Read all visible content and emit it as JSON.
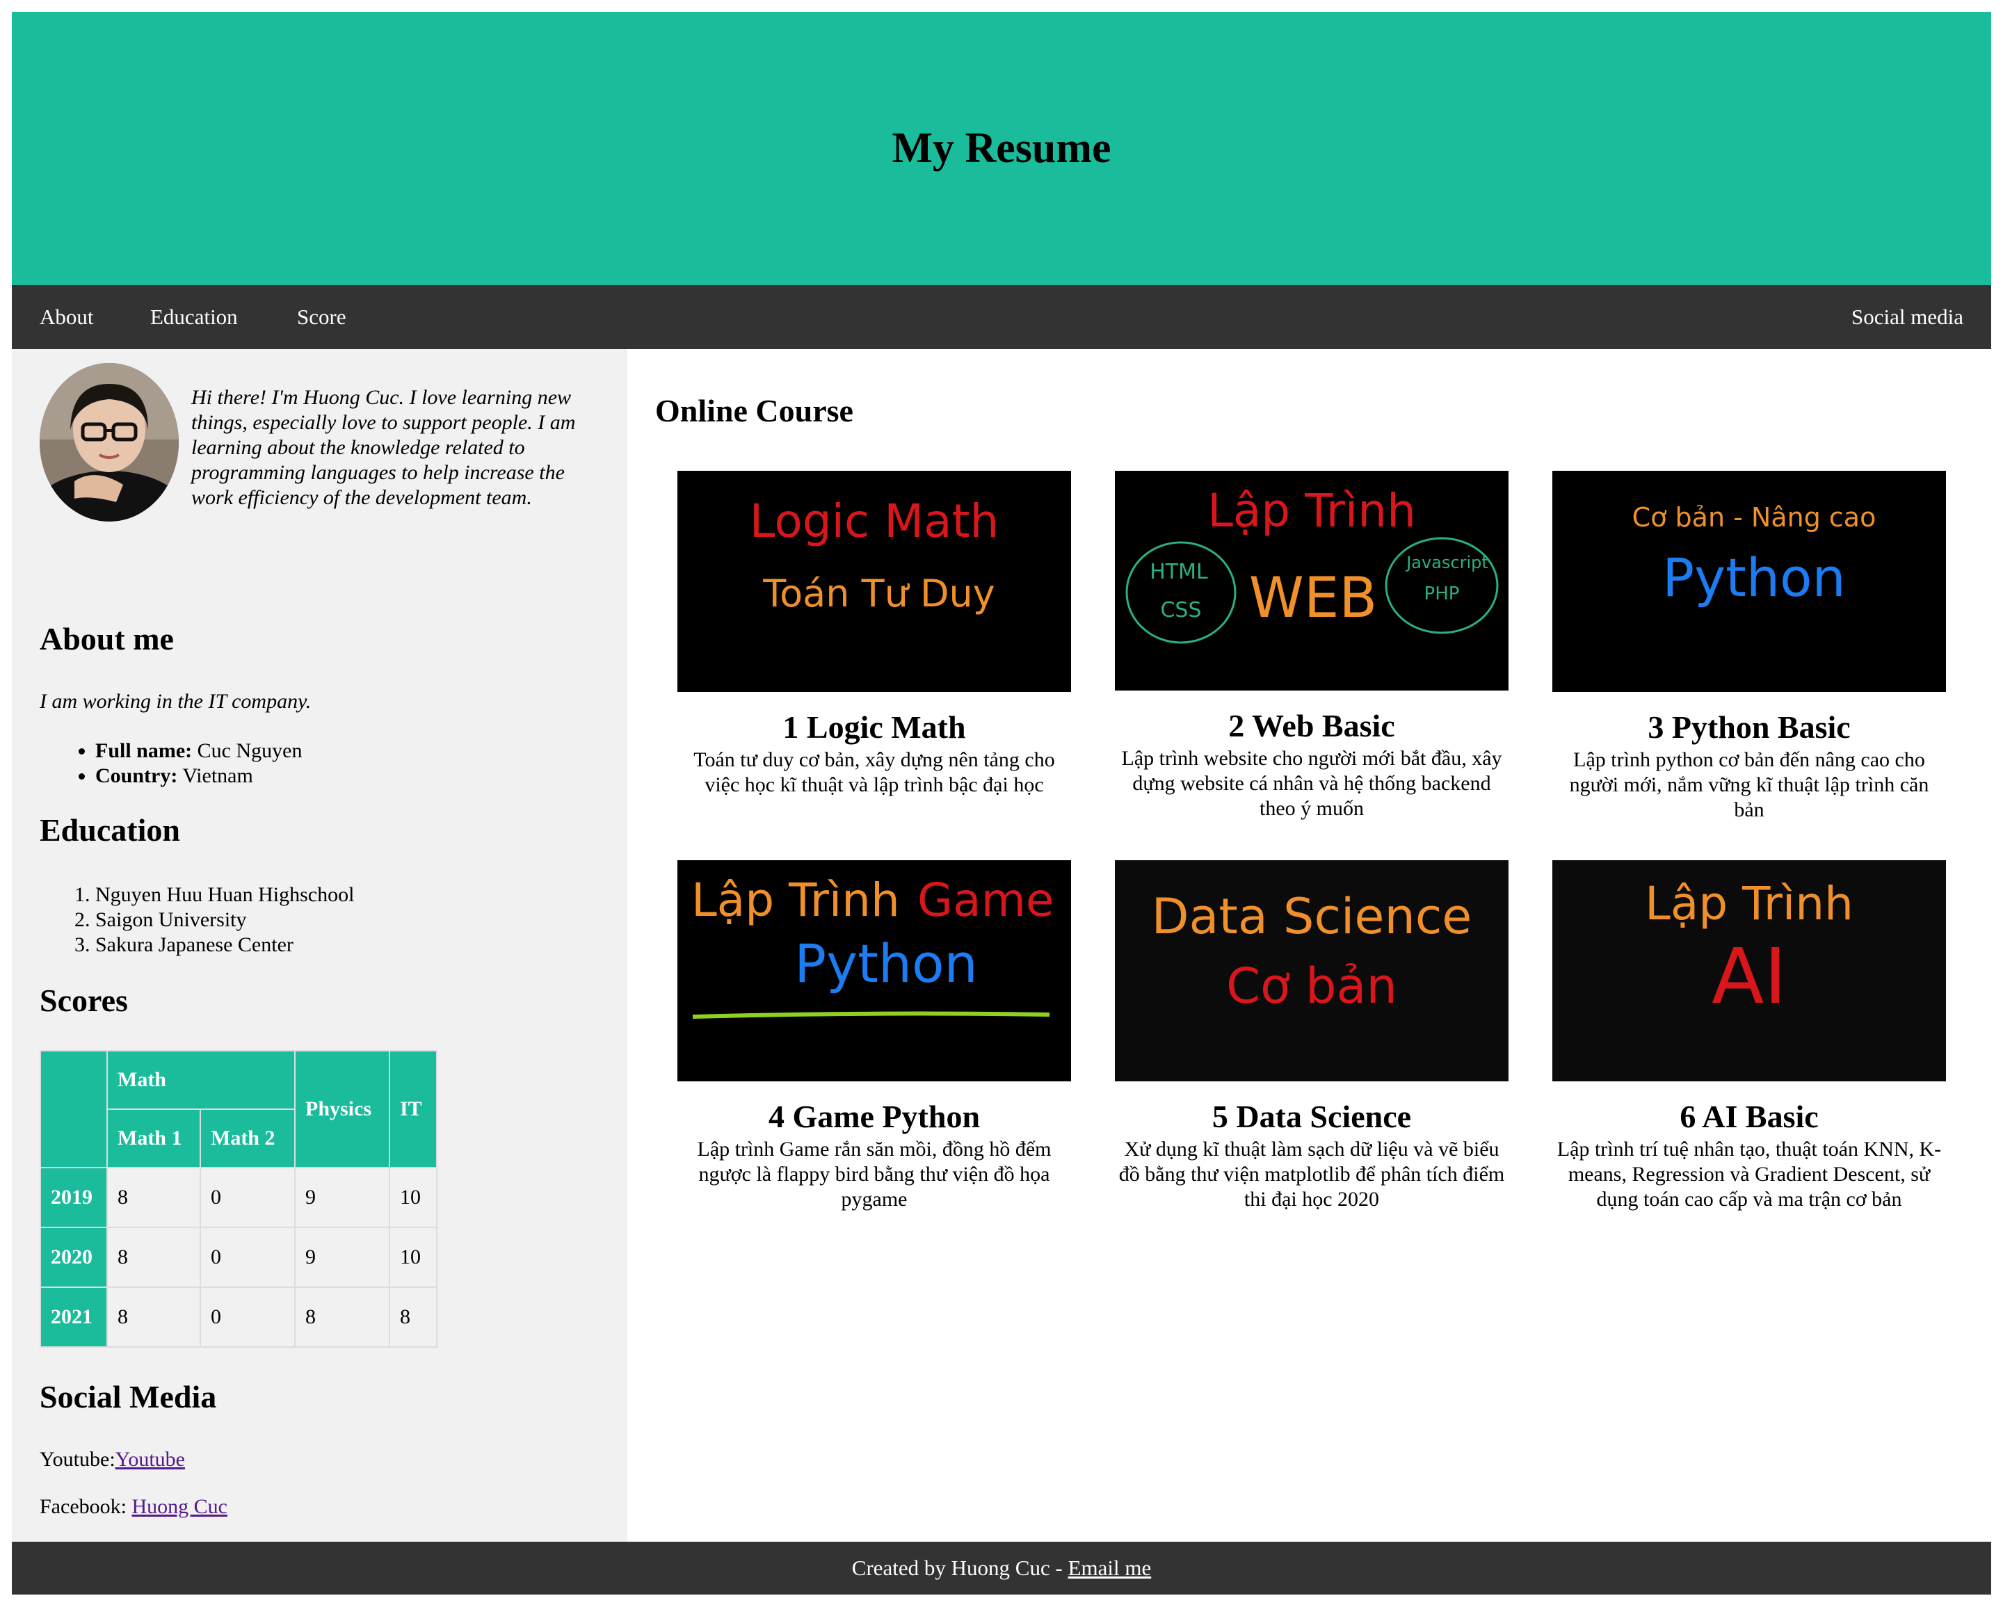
{
  "header": {
    "title": "My Resume"
  },
  "nav": {
    "about": "About",
    "education": "Education",
    "score": "Score",
    "social": "Social media"
  },
  "profile": {
    "intro": "Hi there! I'm Huong Cuc. I love learning new things, especially love to support people. I am learning about the knowledge related to programming languages to help increase the work efficiency of the development team."
  },
  "about": {
    "heading": "About me",
    "text": "I am working in the IT company.",
    "fullname_label": "Full name:",
    "fullname": "Cuc Nguyen",
    "country_label": "Country:",
    "country": "Vietnam"
  },
  "education": {
    "heading": "Education",
    "items": [
      "Nguyen Huu Huan Highschool",
      "Saigon University",
      "Sakura Japanese Center"
    ]
  },
  "scores": {
    "heading": "Scores",
    "headers": {
      "math": "Math",
      "math1": "Math 1",
      "math2": "Math 2",
      "physics": "Physics",
      "it": "IT"
    },
    "rows": [
      {
        "year": "2019",
        "math1": "8",
        "math2": "0",
        "physics": "9",
        "it": "10"
      },
      {
        "year": "2020",
        "math1": "8",
        "math2": "0",
        "physics": "9",
        "it": "10"
      },
      {
        "year": "2021",
        "math1": "8",
        "math2": "0",
        "physics": "8",
        "it": "8"
      }
    ]
  },
  "social": {
    "heading": "Social Media",
    "youtube_label": "Youtube:",
    "youtube_link": "Youtube",
    "facebook_label": "Facebook: ",
    "facebook_link": "Huong Cuc"
  },
  "courses": {
    "heading": "Online Course",
    "items": [
      {
        "title": "1 Logic Math",
        "desc": "Toán tư duy cơ bản, xây dựng nên tảng cho việc học kĩ thuật và lập trình bậc đại học",
        "thumb": {
          "line1": "Logic Math",
          "line2": "Toán Tư Duy"
        }
      },
      {
        "title": "2 Web Basic",
        "desc": "Lập trình website cho người mới bắt đầu, xây dựng website cá nhân và hệ thống backend theo ý muốn",
        "thumb": {
          "line1": "Lập Trình",
          "line2": "WEB",
          "left1": "HTML",
          "left2": "CSS",
          "right1": "Javascript",
          "right2": "PHP"
        }
      },
      {
        "title": "3 Python Basic",
        "desc": "Lập trình python cơ bản đến nâng cao cho người mới, nắm vững kĩ thuật lập trình căn bản",
        "thumb": {
          "line1": "Cơ bản - Nâng cao",
          "line2": "Python"
        }
      },
      {
        "title": "4 Game Python",
        "desc": "Lập trình Game rắn săn mồi, đồng hồ đếm ngược là flappy bird bằng thư viện đồ họa pygame",
        "thumb": {
          "line1a": "Lập Trình",
          "line1b": "Game",
          "line2": "Python"
        }
      },
      {
        "title": "5 Data Science",
        "desc": "Xử dụng kĩ thuật làm sạch dữ liệu và vẽ biểu đồ bằng thư viện matplotlib để phân tích điểm thi đại học 2020",
        "thumb": {
          "line1": "Data Science",
          "line2": "Cơ bản"
        }
      },
      {
        "title": "6 AI Basic",
        "desc": "Lập trình trí tuệ nhân tạo, thuật toán KNN, K-means, Regression và Gradient Descent, sử dụng toán cao cấp và ma trận cơ bản",
        "thumb": {
          "line1": "Lập Trình",
          "line2": "AI"
        }
      }
    ]
  },
  "footer": {
    "text": "Created by Huong Cuc - ",
    "link": "Email me"
  },
  "colors": {
    "accent": "#1abc9c",
    "dark": "#333333",
    "panel": "#f1f1f1"
  }
}
